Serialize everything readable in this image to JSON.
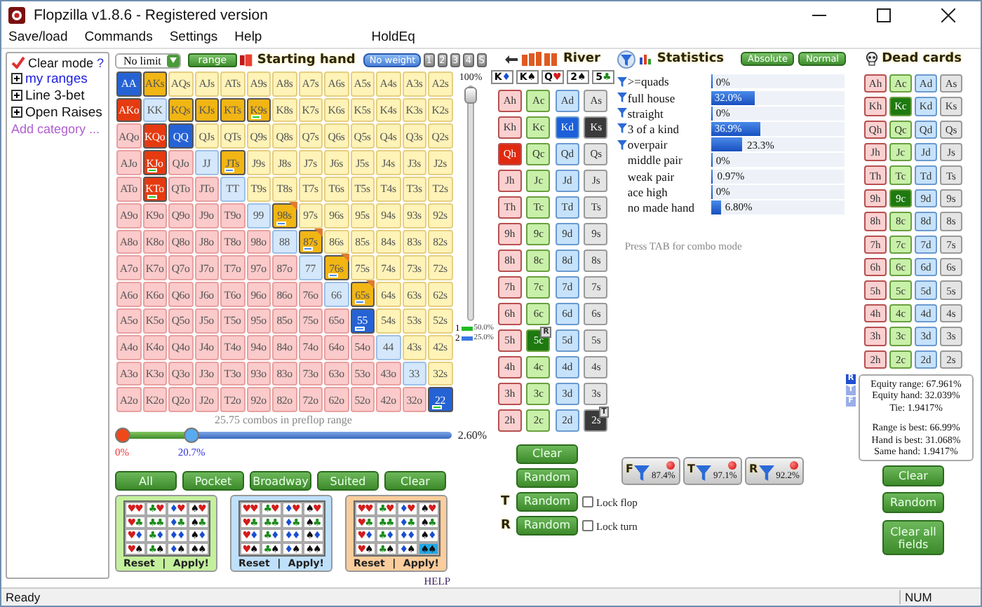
{
  "window": {
    "title": "Flopzilla v1.8.6 - Registered version"
  },
  "menu": {
    "items": [
      "Save/load",
      "Commands",
      "Settings",
      "Help"
    ],
    "extra": "HoldEq"
  },
  "sidebar": {
    "clear_mode": {
      "label": "Clear mode",
      "checked": true
    },
    "help": "?",
    "items": [
      {
        "label": "my ranges",
        "selected": true,
        "expanded": false
      },
      {
        "label": "Line 3-bet",
        "selected": false,
        "expanded": false
      },
      {
        "label": "Open Raises",
        "selected": false,
        "expanded": false
      }
    ],
    "add_link": "Add category ..."
  },
  "range_toolbar": {
    "game": "No limit",
    "range_button": "range",
    "title": "Starting hand",
    "weight_button": "No weight",
    "weight_slots": [
      "1",
      "2",
      "3",
      "4",
      "S"
    ]
  },
  "range_grid": {
    "rows": [
      [
        {
          "label": "AA",
          "selected": true,
          "partial": false
        },
        {
          "label": "AKs",
          "selected": true,
          "partial": false
        },
        {
          "label": "AQs",
          "selected": false,
          "partial": false
        },
        {
          "label": "AJs",
          "selected": false,
          "partial": false
        },
        {
          "label": "ATs",
          "selected": false,
          "partial": false
        },
        {
          "label": "A9s",
          "selected": false,
          "partial": false
        },
        {
          "label": "A8s",
          "selected": false,
          "partial": false
        },
        {
          "label": "A7s",
          "selected": false,
          "partial": false
        },
        {
          "label": "A6s",
          "selected": false,
          "partial": false
        },
        {
          "label": "A5s",
          "selected": false,
          "partial": false
        },
        {
          "label": "A4s",
          "selected": false,
          "partial": false
        },
        {
          "label": "A3s",
          "selected": false,
          "partial": false
        },
        {
          "label": "A2s",
          "selected": false,
          "partial": false
        }
      ],
      [
        {
          "label": "AKo",
          "selected": true,
          "partial": false
        },
        {
          "label": "KK",
          "selected": false,
          "partial": false
        },
        {
          "label": "KQs",
          "selected": true,
          "partial": false
        },
        {
          "label": "KJs",
          "selected": true,
          "partial": false
        },
        {
          "label": "KTs",
          "selected": true,
          "partial": false
        },
        {
          "label": "K9s",
          "selected": true,
          "partial": false,
          "color": "#22cc22"
        },
        {
          "label": "K8s",
          "selected": false,
          "partial": false
        },
        {
          "label": "K7s",
          "selected": false,
          "partial": false
        },
        {
          "label": "K6s",
          "selected": false,
          "partial": false
        },
        {
          "label": "K5s",
          "selected": false,
          "partial": false
        },
        {
          "label": "K4s",
          "selected": false,
          "partial": false
        },
        {
          "label": "K3s",
          "selected": false,
          "partial": false
        },
        {
          "label": "K2s",
          "selected": false,
          "partial": false
        }
      ],
      [
        {
          "label": "AQo",
          "selected": false,
          "partial": false
        },
        {
          "label": "KQo",
          "selected": true,
          "partial": false
        },
        {
          "label": "QQ",
          "selected": true,
          "partial": false
        },
        {
          "label": "QJs",
          "selected": false,
          "partial": false
        },
        {
          "label": "QTs",
          "selected": false,
          "partial": false
        },
        {
          "label": "Q9s",
          "selected": false,
          "partial": false
        },
        {
          "label": "Q8s",
          "selected": false,
          "partial": false
        },
        {
          "label": "Q7s",
          "selected": false,
          "partial": false
        },
        {
          "label": "Q6s",
          "selected": false,
          "partial": false
        },
        {
          "label": "Q5s",
          "selected": false,
          "partial": false
        },
        {
          "label": "Q4s",
          "selected": false,
          "partial": false
        },
        {
          "label": "Q3s",
          "selected": false,
          "partial": false
        },
        {
          "label": "Q2s",
          "selected": false,
          "partial": false
        }
      ],
      [
        {
          "label": "AJo",
          "selected": false,
          "partial": false
        },
        {
          "label": "KJo",
          "selected": true,
          "partial": false,
          "color": "#22cc22"
        },
        {
          "label": "QJo",
          "selected": false,
          "partial": false
        },
        {
          "label": "JJ",
          "selected": false,
          "partial": false
        },
        {
          "label": "JTs",
          "selected": true,
          "partial": false,
          "color": "#4a8af0"
        },
        {
          "label": "J9s",
          "selected": false,
          "partial": false
        },
        {
          "label": "J8s",
          "selected": false,
          "partial": false
        },
        {
          "label": "J7s",
          "selected": false,
          "partial": false
        },
        {
          "label": "J6s",
          "selected": false,
          "partial": false
        },
        {
          "label": "J5s",
          "selected": false,
          "partial": false
        },
        {
          "label": "J4s",
          "selected": false,
          "partial": false
        },
        {
          "label": "J3s",
          "selected": false,
          "partial": false
        },
        {
          "label": "J2s",
          "selected": false,
          "partial": false
        }
      ],
      [
        {
          "label": "ATo",
          "selected": false,
          "partial": false
        },
        {
          "label": "KTo",
          "selected": true,
          "partial": false,
          "color": "#22cc22"
        },
        {
          "label": "QTo",
          "selected": false,
          "partial": false
        },
        {
          "label": "JTo",
          "selected": false,
          "partial": false
        },
        {
          "label": "TT",
          "selected": false,
          "partial": false
        },
        {
          "label": "T9s",
          "selected": false,
          "partial": false
        },
        {
          "label": "T8s",
          "selected": false,
          "partial": false
        },
        {
          "label": "T7s",
          "selected": false,
          "partial": false
        },
        {
          "label": "T6s",
          "selected": false,
          "partial": false
        },
        {
          "label": "T5s",
          "selected": false,
          "partial": false
        },
        {
          "label": "T4s",
          "selected": false,
          "partial": false
        },
        {
          "label": "T3s",
          "selected": false,
          "partial": false
        },
        {
          "label": "T2s",
          "selected": false,
          "partial": false
        }
      ],
      [
        {
          "label": "A9o",
          "selected": false,
          "partial": false
        },
        {
          "label": "K9o",
          "selected": false,
          "partial": false
        },
        {
          "label": "Q9o",
          "selected": false,
          "partial": false
        },
        {
          "label": "J9o",
          "selected": false,
          "partial": false
        },
        {
          "label": "T9o",
          "selected": false,
          "partial": false
        },
        {
          "label": "99",
          "selected": false,
          "partial": false
        },
        {
          "label": "98s",
          "selected": true,
          "partial": true,
          "color": "#4a8af0"
        },
        {
          "label": "97s",
          "selected": false,
          "partial": false
        },
        {
          "label": "96s",
          "selected": false,
          "partial": false
        },
        {
          "label": "95s",
          "selected": false,
          "partial": false
        },
        {
          "label": "94s",
          "selected": false,
          "partial": false
        },
        {
          "label": "93s",
          "selected": false,
          "partial": false
        },
        {
          "label": "92s",
          "selected": false,
          "partial": false
        }
      ],
      [
        {
          "label": "A8o",
          "selected": false,
          "partial": false
        },
        {
          "label": "K8o",
          "selected": false,
          "partial": false
        },
        {
          "label": "Q8o",
          "selected": false,
          "partial": false
        },
        {
          "label": "J8o",
          "selected": false,
          "partial": false
        },
        {
          "label": "T8o",
          "selected": false,
          "partial": false
        },
        {
          "label": "98o",
          "selected": false,
          "partial": false
        },
        {
          "label": "88",
          "selected": false,
          "partial": false
        },
        {
          "label": "87s",
          "selected": true,
          "partial": true,
          "color": "#4a8af0"
        },
        {
          "label": "86s",
          "selected": false,
          "partial": false
        },
        {
          "label": "85s",
          "selected": false,
          "partial": false
        },
        {
          "label": "84s",
          "selected": false,
          "partial": false
        },
        {
          "label": "83s",
          "selected": false,
          "partial": false
        },
        {
          "label": "82s",
          "selected": false,
          "partial": false
        }
      ],
      [
        {
          "label": "A7o",
          "selected": false,
          "partial": false
        },
        {
          "label": "K7o",
          "selected": false,
          "partial": false
        },
        {
          "label": "Q7o",
          "selected": false,
          "partial": false
        },
        {
          "label": "J7o",
          "selected": false,
          "partial": false
        },
        {
          "label": "T7o",
          "selected": false,
          "partial": false
        },
        {
          "label": "97o",
          "selected": false,
          "partial": false
        },
        {
          "label": "87o",
          "selected": false,
          "partial": false
        },
        {
          "label": "77",
          "selected": false,
          "partial": false
        },
        {
          "label": "76s",
          "selected": true,
          "partial": true,
          "color": "#4a8af0"
        },
        {
          "label": "75s",
          "selected": false,
          "partial": false
        },
        {
          "label": "74s",
          "selected": false,
          "partial": false
        },
        {
          "label": "73s",
          "selected": false,
          "partial": false
        },
        {
          "label": "72s",
          "selected": false,
          "partial": false
        }
      ],
      [
        {
          "label": "A6o",
          "selected": false,
          "partial": false
        },
        {
          "label": "K6o",
          "selected": false,
          "partial": false
        },
        {
          "label": "Q6o",
          "selected": false,
          "partial": false
        },
        {
          "label": "J6o",
          "selected": false,
          "partial": false
        },
        {
          "label": "T6o",
          "selected": false,
          "partial": false
        },
        {
          "label": "96o",
          "selected": false,
          "partial": false
        },
        {
          "label": "86o",
          "selected": false,
          "partial": false
        },
        {
          "label": "76o",
          "selected": false,
          "partial": false
        },
        {
          "label": "66",
          "selected": false,
          "partial": false
        },
        {
          "label": "65s",
          "selected": true,
          "partial": true,
          "color": "#4a8af0"
        },
        {
          "label": "64s",
          "selected": false,
          "partial": false
        },
        {
          "label": "63s",
          "selected": false,
          "partial": false
        },
        {
          "label": "62s",
          "selected": false,
          "partial": false
        }
      ],
      [
        {
          "label": "A5o",
          "selected": false,
          "partial": false
        },
        {
          "label": "K5o",
          "selected": false,
          "partial": false
        },
        {
          "label": "Q5o",
          "selected": false,
          "partial": false
        },
        {
          "label": "J5o",
          "selected": false,
          "partial": false
        },
        {
          "label": "T5o",
          "selected": false,
          "partial": false
        },
        {
          "label": "95o",
          "selected": false,
          "partial": false
        },
        {
          "label": "85o",
          "selected": false,
          "partial": false
        },
        {
          "label": "75o",
          "selected": false,
          "partial": false
        },
        {
          "label": "65o",
          "selected": false,
          "partial": false
        },
        {
          "label": "55",
          "selected": true,
          "partial": false,
          "color": "#4a8af0"
        },
        {
          "label": "54s",
          "selected": false,
          "partial": false
        },
        {
          "label": "53s",
          "selected": false,
          "partial": false
        },
        {
          "label": "52s",
          "selected": false,
          "partial": false
        }
      ],
      [
        {
          "label": "A4o",
          "selected": false,
          "partial": false
        },
        {
          "label": "K4o",
          "selected": false,
          "partial": false
        },
        {
          "label": "Q4o",
          "selected": false,
          "partial": false
        },
        {
          "label": "J4o",
          "selected": false,
          "partial": false
        },
        {
          "label": "T4o",
          "selected": false,
          "partial": false
        },
        {
          "label": "94o",
          "selected": false,
          "partial": false
        },
        {
          "label": "84o",
          "selected": false,
          "partial": false
        },
        {
          "label": "74o",
          "selected": false,
          "partial": false
        },
        {
          "label": "64o",
          "selected": false,
          "partial": false
        },
        {
          "label": "54o",
          "selected": false,
          "partial": false
        },
        {
          "label": "44",
          "selected": false,
          "partial": false
        },
        {
          "label": "43s",
          "selected": false,
          "partial": false
        },
        {
          "label": "42s",
          "selected": false,
          "partial": false
        }
      ],
      [
        {
          "label": "A3o",
          "selected": false,
          "partial": false
        },
        {
          "label": "K3o",
          "selected": false,
          "partial": false
        },
        {
          "label": "Q3o",
          "selected": false,
          "partial": false
        },
        {
          "label": "J3o",
          "selected": false,
          "partial": false
        },
        {
          "label": "T3o",
          "selected": false,
          "partial": false
        },
        {
          "label": "93o",
          "selected": false,
          "partial": false
        },
        {
          "label": "83o",
          "selected": false,
          "partial": false
        },
        {
          "label": "73o",
          "selected": false,
          "partial": false
        },
        {
          "label": "63o",
          "selected": false,
          "partial": false
        },
        {
          "label": "53o",
          "selected": false,
          "partial": false
        },
        {
          "label": "43o",
          "selected": false,
          "partial": false
        },
        {
          "label": "33",
          "selected": false,
          "partial": false
        },
        {
          "label": "32s",
          "selected": false,
          "partial": false
        }
      ],
      [
        {
          "label": "A2o",
          "selected": false,
          "partial": false
        },
        {
          "label": "K2o",
          "selected": false,
          "partial": false
        },
        {
          "label": "Q2o",
          "selected": false,
          "partial": false
        },
        {
          "label": "J2o",
          "selected": false,
          "partial": false
        },
        {
          "label": "T2o",
          "selected": false,
          "partial": false
        },
        {
          "label": "92o",
          "selected": false,
          "partial": false
        },
        {
          "label": "82o",
          "selected": false,
          "partial": false
        },
        {
          "label": "72o",
          "selected": false,
          "partial": false
        },
        {
          "label": "62o",
          "selected": false,
          "partial": false
        },
        {
          "label": "52o",
          "selected": false,
          "partial": false
        },
        {
          "label": "42o",
          "selected": false,
          "partial": false
        },
        {
          "label": "32o",
          "selected": false,
          "partial": false
        },
        {
          "label": "22",
          "selected": true,
          "partial": false,
          "color": "#22cc22"
        }
      ]
    ]
  },
  "weight_slider": {
    "label": "100%",
    "level": 1,
    "legend": [
      {
        "label": "1",
        "color": "#22bb22",
        "value": "50.0%"
      },
      {
        "label": "2",
        "color": "#3a78e0",
        "value": "25.0%"
      }
    ]
  },
  "combos": "25.75 combos in preflop range",
  "range_slider": {
    "low": {
      "level": 0,
      "label": "0%"
    },
    "high": {
      "level": 0.207,
      "label": "20.7%"
    },
    "reading": "2.60%"
  },
  "range_buttons": [
    "All",
    "Pocket",
    "Broadway",
    "Suited",
    "Clear"
  ],
  "suit_boxes": [
    {
      "color": "#c4f09c",
      "cells": [
        {
          "label": "♥♥",
          "selected": false
        },
        {
          "label": "♣♥",
          "selected": false
        },
        {
          "label": "♦♥",
          "selected": false
        },
        {
          "label": "♠♥",
          "selected": false
        },
        {
          "label": "♥♣",
          "selected": false
        },
        {
          "label": "♣♣",
          "selected": false
        },
        {
          "label": "♦♣",
          "selected": false
        },
        {
          "label": "♠♣",
          "selected": false
        },
        {
          "label": "♥♦",
          "selected": false
        },
        {
          "label": "♣♦",
          "selected": false
        },
        {
          "label": "♦♦",
          "selected": false
        },
        {
          "label": "♠♦",
          "selected": false
        },
        {
          "label": "♥♠",
          "selected": false
        },
        {
          "label": "♣♠",
          "selected": false
        },
        {
          "label": "♦♠",
          "selected": false
        },
        {
          "label": "♠♠",
          "selected": false
        }
      ],
      "reset": "Reset",
      "separator": "|",
      "apply": "Apply!"
    },
    {
      "color": "#bfe0fb",
      "cells": [
        {
          "label": "♥♥",
          "selected": false
        },
        {
          "label": "♣♥",
          "selected": false
        },
        {
          "label": "♦♥",
          "selected": false
        },
        {
          "label": "♠♥",
          "selected": false
        },
        {
          "label": "♥♣",
          "selected": false
        },
        {
          "label": "♣♣",
          "selected": false
        },
        {
          "label": "♦♣",
          "selected": false
        },
        {
          "label": "♠♣",
          "selected": false
        },
        {
          "label": "♥♦",
          "selected": false
        },
        {
          "label": "♣♦",
          "selected": false
        },
        {
          "label": "♦♦",
          "selected": false
        },
        {
          "label": "♠♦",
          "selected": false
        },
        {
          "label": "♥♠",
          "selected": false
        },
        {
          "label": "♣♠",
          "selected": false
        },
        {
          "label": "♦♠",
          "selected": false
        },
        {
          "label": "♠♠",
          "selected": false
        }
      ],
      "reset": "Reset",
      "separator": "|",
      "apply": "Apply!"
    },
    {
      "color": "#fbcd9c",
      "cells": [
        {
          "label": "♥♥",
          "selected": false
        },
        {
          "label": "♣♥",
          "selected": false
        },
        {
          "label": "♦♥",
          "selected": false
        },
        {
          "label": "♠♥",
          "selected": false
        },
        {
          "label": "♥♣",
          "selected": false
        },
        {
          "label": "♣♣",
          "selected": false
        },
        {
          "label": "♦♣",
          "selected": false
        },
        {
          "label": "♠♣",
          "selected": false
        },
        {
          "label": "♥♦",
          "selected": false
        },
        {
          "label": "♣♦",
          "selected": false
        },
        {
          "label": "♦♦",
          "selected": false
        },
        {
          "label": "♠♦",
          "selected": false
        },
        {
          "label": "♥♠",
          "selected": false
        },
        {
          "label": "♣♠",
          "selected": false
        },
        {
          "label": "♦♠",
          "selected": false
        },
        {
          "label": "♠♠",
          "selected": true
        }
      ],
      "reset": "Reset",
      "separator": "|",
      "apply": "Apply!"
    }
  ],
  "help_link": "HELP",
  "board": {
    "title": "River",
    "cards": [
      {
        "rank": "K",
        "suit": "♦",
        "kind": "diamond"
      },
      {
        "rank": "K",
        "suit": "♠",
        "kind": "spade"
      },
      {
        "rank": "Q",
        "suit": "♥",
        "kind": "heart"
      },
      {
        "rank": "2",
        "suit": "♠",
        "kind": "spade"
      },
      {
        "rank": "5",
        "suit": "♣",
        "kind": "club"
      }
    ],
    "grid": [
      [
        {
          "label": "Ah",
          "selected": false
        },
        {
          "label": "Ac",
          "selected": false
        },
        {
          "label": "Ad",
          "selected": false
        },
        {
          "label": "As",
          "selected": false
        }
      ],
      [
        {
          "label": "Kh",
          "selected": false
        },
        {
          "label": "Kc",
          "selected": false
        },
        {
          "label": "Kd",
          "selected": true
        },
        {
          "label": "Ks",
          "selected": true
        }
      ],
      [
        {
          "label": "Qh",
          "selected": true
        },
        {
          "label": "Qc",
          "selected": false
        },
        {
          "label": "Qd",
          "selected": false
        },
        {
          "label": "Qs",
          "selected": false
        }
      ],
      [
        {
          "label": "Jh",
          "selected": false
        },
        {
          "label": "Jc",
          "selected": false
        },
        {
          "label": "Jd",
          "selected": false
        },
        {
          "label": "Js",
          "selected": false
        }
      ],
      [
        {
          "label": "Th",
          "selected": false
        },
        {
          "label": "Tc",
          "selected": false
        },
        {
          "label": "Td",
          "selected": false
        },
        {
          "label": "Ts",
          "selected": false
        }
      ],
      [
        {
          "label": "9h",
          "selected": false
        },
        {
          "label": "9c",
          "selected": false
        },
        {
          "label": "9d",
          "selected": false
        },
        {
          "label": "9s",
          "selected": false
        }
      ],
      [
        {
          "label": "8h",
          "selected": false
        },
        {
          "label": "8c",
          "selected": false
        },
        {
          "label": "8d",
          "selected": false
        },
        {
          "label": "8s",
          "selected": false
        }
      ],
      [
        {
          "label": "7h",
          "selected": false
        },
        {
          "label": "7c",
          "selected": false
        },
        {
          "label": "7d",
          "selected": false
        },
        {
          "label": "7s",
          "selected": false
        }
      ],
      [
        {
          "label": "6h",
          "selected": false
        },
        {
          "label": "6c",
          "selected": false
        },
        {
          "label": "6d",
          "selected": false
        },
        {
          "label": "6s",
          "selected": false
        }
      ],
      [
        {
          "label": "5h",
          "selected": false
        },
        {
          "label": "5c",
          "selected": true,
          "badge": "R"
        },
        {
          "label": "5d",
          "selected": false
        },
        {
          "label": "5s",
          "selected": false
        }
      ],
      [
        {
          "label": "4h",
          "selected": false
        },
        {
          "label": "4c",
          "selected": false
        },
        {
          "label": "4d",
          "selected": false
        },
        {
          "label": "4s",
          "selected": false
        }
      ],
      [
        {
          "label": "3h",
          "selected": false
        },
        {
          "label": "3c",
          "selected": false
        },
        {
          "label": "3d",
          "selected": false
        },
        {
          "label": "3s",
          "selected": false
        }
      ],
      [
        {
          "label": "2h",
          "selected": false
        },
        {
          "label": "2c",
          "selected": false
        },
        {
          "label": "2d",
          "selected": false
        },
        {
          "label": "2s",
          "selected": true,
          "badge": "T"
        }
      ]
    ]
  },
  "board_buttons": {
    "clear": "Clear",
    "random": "Random",
    "streets": [
      {
        "letter": "T",
        "button": "Random",
        "lock_label": "Lock flop",
        "locked": false
      },
      {
        "letter": "R",
        "button": "Random",
        "lock_label": "Lock turn",
        "locked": false
      }
    ]
  },
  "filters": [
    {
      "letter": "F",
      "value": "87.4%"
    },
    {
      "letter": "T",
      "value": "97.1%"
    },
    {
      "letter": "R",
      "value": "92.2%"
    }
  ],
  "statistics": {
    "title": "Statistics",
    "modes": [
      "Absolute",
      "Normal"
    ],
    "rows": [
      {
        "label": ">=quads",
        "filtered": true,
        "level": 0,
        "value": "0%"
      },
      {
        "label": "full house",
        "filtered": true,
        "level": 0.32,
        "value": "32.0%"
      },
      {
        "label": "straight",
        "filtered": true,
        "level": 0,
        "value": "0%"
      },
      {
        "label": "3 of a kind",
        "filtered": true,
        "level": 0.369,
        "value": "36.9%"
      },
      {
        "label": "overpair",
        "filtered": true,
        "level": 0.233,
        "value": "23.3%"
      },
      {
        "label": "middle pair",
        "filtered": false,
        "level": 0,
        "value": "0%"
      },
      {
        "label": "weak pair",
        "filtered": false,
        "level": 0.0097,
        "value": "0.97%"
      },
      {
        "label": "ace high",
        "filtered": false,
        "level": 0,
        "value": "0%"
      },
      {
        "label": "no made hand",
        "filtered": false,
        "level": 0.068,
        "value": "6.80%"
      }
    ],
    "hint": "Press TAB for combo mode"
  },
  "dead_cards": {
    "title": "Dead cards",
    "grid": [
      [
        {
          "label": "Ah",
          "selected": false
        },
        {
          "label": "Ac",
          "selected": false
        },
        {
          "label": "Ad",
          "selected": false
        },
        {
          "label": "As",
          "selected": false
        }
      ],
      [
        {
          "label": "Kh",
          "selected": false
        },
        {
          "label": "Kc",
          "selected": true
        },
        {
          "label": "Kd",
          "selected": false
        },
        {
          "label": "Ks",
          "selected": false
        }
      ],
      [
        {
          "label": "Qh",
          "selected": false
        },
        {
          "label": "Qc",
          "selected": false
        },
        {
          "label": "Qd",
          "selected": false
        },
        {
          "label": "Qs",
          "selected": false
        }
      ],
      [
        {
          "label": "Jh",
          "selected": false
        },
        {
          "label": "Jc",
          "selected": false
        },
        {
          "label": "Jd",
          "selected": false
        },
        {
          "label": "Js",
          "selected": false
        }
      ],
      [
        {
          "label": "Th",
          "selected": false
        },
        {
          "label": "Tc",
          "selected": false
        },
        {
          "label": "Td",
          "selected": false
        },
        {
          "label": "Ts",
          "selected": false
        }
      ],
      [
        {
          "label": "9h",
          "selected": false
        },
        {
          "label": "9c",
          "selected": true
        },
        {
          "label": "9d",
          "selected": false
        },
        {
          "label": "9s",
          "selected": false
        }
      ],
      [
        {
          "label": "8h",
          "selected": false
        },
        {
          "label": "8c",
          "selected": false
        },
        {
          "label": "8d",
          "selected": false
        },
        {
          "label": "8s",
          "selected": false
        }
      ],
      [
        {
          "label": "7h",
          "selected": false
        },
        {
          "label": "7c",
          "selected": false
        },
        {
          "label": "7d",
          "selected": false
        },
        {
          "label": "7s",
          "selected": false
        }
      ],
      [
        {
          "label": "6h",
          "selected": false
        },
        {
          "label": "6c",
          "selected": false
        },
        {
          "label": "6d",
          "selected": false
        },
        {
          "label": "6s",
          "selected": false
        }
      ],
      [
        {
          "label": "5h",
          "selected": false
        },
        {
          "label": "5c",
          "selected": false
        },
        {
          "label": "5d",
          "selected": false
        },
        {
          "label": "5s",
          "selected": false
        }
      ],
      [
        {
          "label": "4h",
          "selected": false
        },
        {
          "label": "4c",
          "selected": false
        },
        {
          "label": "4d",
          "selected": false
        },
        {
          "label": "4s",
          "selected": false
        }
      ],
      [
        {
          "label": "3h",
          "selected": false
        },
        {
          "label": "3c",
          "selected": false
        },
        {
          "label": "3d",
          "selected": false
        },
        {
          "label": "3s",
          "selected": false
        }
      ],
      [
        {
          "label": "2h",
          "selected": false
        },
        {
          "label": "2c",
          "selected": false
        },
        {
          "label": "2d",
          "selected": false
        },
        {
          "label": "2s",
          "selected": false
        }
      ]
    ]
  },
  "equity": {
    "streets": [
      {
        "label": "R",
        "selected": true
      },
      {
        "label": "T",
        "selected": false
      },
      {
        "label": "F",
        "selected": false
      }
    ],
    "lines": [
      "Equity range: 67.961%",
      "Equity hand: 32.039%",
      "Tie: 1.9417%"
    ],
    "best_lines": [
      "Range is best: 66.99%",
      "Hand is best: 31.068%",
      "Same hand: 1.9417%"
    ]
  },
  "dead_buttons": [
    "Clear",
    "Random",
    "Clear all fields"
  ],
  "status_bar": {
    "text": "Ready",
    "num": "NUM"
  }
}
